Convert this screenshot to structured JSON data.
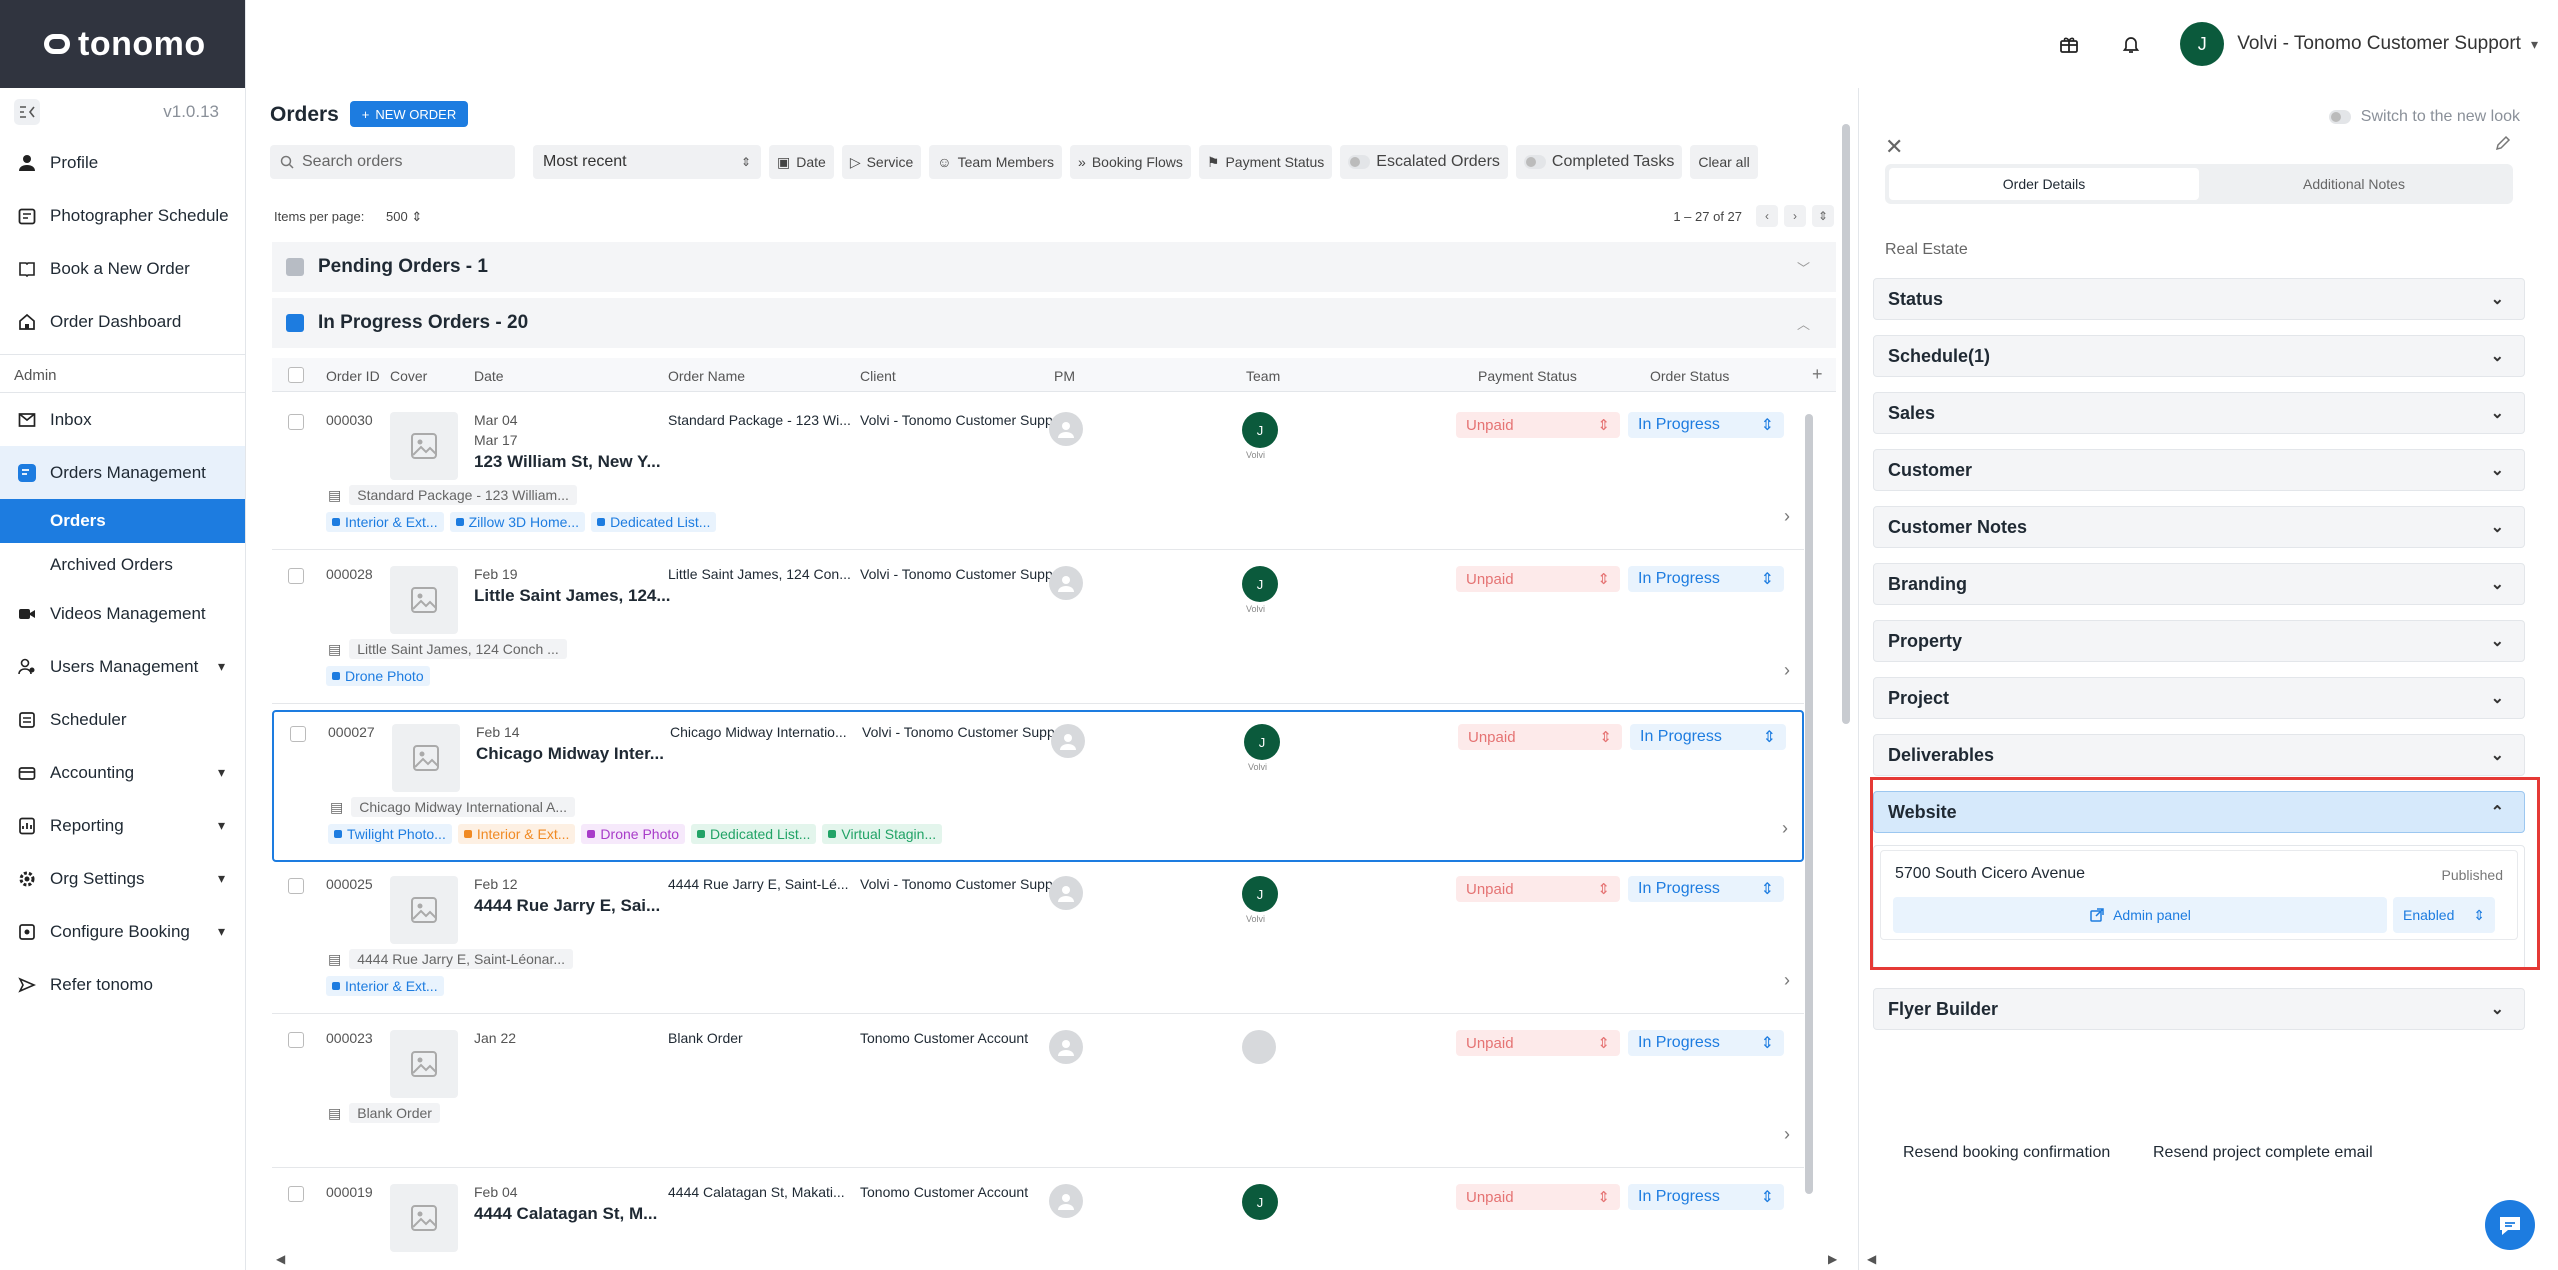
{
  "brand": {
    "name": "tonomo"
  },
  "sidebar": {
    "version": "v1.0.13",
    "items": [
      {
        "label": "Profile",
        "icon": "person-icon"
      },
      {
        "label": "Photographer Schedule",
        "icon": "calendar-icon"
      },
      {
        "label": "Book a New Order",
        "icon": "book-icon"
      },
      {
        "label": "Order Dashboard",
        "icon": "home-icon"
      }
    ],
    "admin_label": "Admin",
    "admin_items": [
      {
        "label": "Inbox",
        "icon": "inbox-icon"
      },
      {
        "label": "Orders Management",
        "icon": "orders-icon"
      },
      {
        "label": "Orders",
        "icon": ""
      },
      {
        "label": "Archived Orders",
        "icon": ""
      },
      {
        "label": "Videos Management",
        "icon": "video-icon"
      },
      {
        "label": "Users Management",
        "icon": "users-icon"
      },
      {
        "label": "Scheduler",
        "icon": "scheduler-icon"
      },
      {
        "label": "Accounting",
        "icon": "accounting-icon"
      },
      {
        "label": "Reporting",
        "icon": "reporting-icon"
      },
      {
        "label": "Org Settings",
        "icon": "gear-icon"
      },
      {
        "label": "Configure Booking",
        "icon": "configure-icon"
      },
      {
        "label": "Refer tonomo",
        "icon": "send-icon"
      }
    ]
  },
  "header": {
    "user_initial": "J",
    "user_name": "Volvi - Tonomo Customer Support"
  },
  "orders": {
    "title": "Orders",
    "new_order_label": "NEW ORDER",
    "search_placeholder": "Search orders",
    "sort_value": "Most recent",
    "filters": [
      "Date",
      "Service",
      "Team Members",
      "Booking Flows",
      "Payment Status",
      "Escalated Orders",
      "Completed Tasks",
      "Clear all"
    ],
    "items_per_page_label": "Items per page:",
    "items_per_page_value": "500",
    "range_label": "1 – 27 of 27",
    "groups": [
      {
        "label": "Pending Orders - 1",
        "color": "#b7bcc4"
      },
      {
        "label": "In Progress Orders - 20",
        "color": "#1d7ce0"
      }
    ],
    "columns": [
      "Order ID",
      "Cover",
      "Date",
      "Order Name",
      "Client",
      "PM",
      "Team",
      "Payment Status",
      "Order Status"
    ],
    "rows": [
      {
        "id": "000030",
        "date1": "Mar 04",
        "date2": "Mar 17",
        "address": "123 William St, New Y...",
        "order_name": "Standard Package - 123 Wi...",
        "client": "Volvi - Tonomo Customer Support",
        "team_initial": "J",
        "team_name": "Volvi",
        "payment": "Unpaid",
        "status": "In Progress",
        "note": "Standard Package - 123 William...",
        "tags": [
          {
            "label": "Interior & Ext...",
            "color": "#1d7ce0",
            "bg": "#e9f3fd"
          },
          {
            "label": "Zillow 3D Home...",
            "color": "#1d7ce0",
            "bg": "#e9f3fd"
          },
          {
            "label": "Dedicated List...",
            "color": "#1d7ce0",
            "bg": "#e9f3fd"
          }
        ]
      },
      {
        "id": "000028",
        "date1": "Feb 19",
        "date2": "",
        "address": "Little Saint James, 124...",
        "order_name": "Little Saint James, 124 Con...",
        "client": "Volvi - Tonomo Customer Support",
        "team_initial": "J",
        "team_name": "Volvi",
        "payment": "Unpaid",
        "status": "In Progress",
        "note": "Little Saint James, 124 Conch ...",
        "tags": [
          {
            "label": "Drone Photo",
            "color": "#1d7ce0",
            "bg": "#e9f3fd"
          }
        ]
      },
      {
        "id": "000027",
        "date1": "Feb 14",
        "date2": "",
        "address": "Chicago Midway Inter...",
        "order_name": "Chicago Midway Internatio...",
        "client": "Volvi - Tonomo Customer Support",
        "team_initial": "J",
        "team_name": "Volvi",
        "payment": "Unpaid",
        "status": "In Progress",
        "note": "Chicago Midway International A...",
        "tags": [
          {
            "label": "Twilight Photo...",
            "color": "#1d7ce0",
            "bg": "#e9f3fd"
          },
          {
            "label": "Interior & Ext...",
            "color": "#f08a24",
            "bg": "#fdf0e3"
          },
          {
            "label": "Drone Photo",
            "color": "#a83cc9",
            "bg": "#f6e9fb"
          },
          {
            "label": "Dedicated List...",
            "color": "#21a366",
            "bg": "#e3f5ec"
          },
          {
            "label": "Virtual Stagin...",
            "color": "#21a366",
            "bg": "#e3f5ec"
          }
        ]
      },
      {
        "id": "000025",
        "date1": "Feb 12",
        "date2": "",
        "address": "4444 Rue Jarry E, Sai...",
        "order_name": "4444 Rue Jarry E, Saint-Lé...",
        "client": "Volvi - Tonomo Customer Support",
        "team_initial": "J",
        "team_name": "Volvi",
        "payment": "Unpaid",
        "status": "In Progress",
        "note": "4444 Rue Jarry E, Saint-Léonar...",
        "tags": [
          {
            "label": "Interior & Ext...",
            "color": "#1d7ce0",
            "bg": "#e9f3fd"
          }
        ]
      },
      {
        "id": "000023",
        "date1": "Jan 22",
        "date2": "",
        "address": "",
        "order_name": "Blank Order",
        "client": "Tonomo Customer Account",
        "team_initial": "",
        "team_name": "",
        "payment": "Unpaid",
        "status": "In Progress",
        "note": "Blank Order",
        "tags": []
      },
      {
        "id": "000019",
        "date1": "Feb 04",
        "date2": "",
        "address": "4444 Calatagan St, M...",
        "order_name": "4444 Calatagan St, Makati...",
        "client": "Tonomo Customer Account",
        "team_initial": "J",
        "team_name": "",
        "payment": "Unpaid",
        "status": "In Progress",
        "note": "",
        "tags": []
      }
    ]
  },
  "panel": {
    "switch_label": "Switch to the new look",
    "tabs": [
      "Order Details",
      "Additional Notes"
    ],
    "section_label": "Real Estate",
    "accordions": [
      "Status",
      "Schedule(1)",
      "Sales",
      "Customer",
      "Customer Notes",
      "Branding",
      "Property",
      "Project",
      "Deliverables",
      "Website",
      "Flyer Builder"
    ],
    "website": {
      "title": "5700 South Cicero Avenue",
      "status": "Published",
      "admin_label": "Admin panel",
      "enabled_value": "Enabled"
    },
    "resend_booking": "Resend booking confirmation",
    "resend_complete": "Resend project complete email"
  }
}
